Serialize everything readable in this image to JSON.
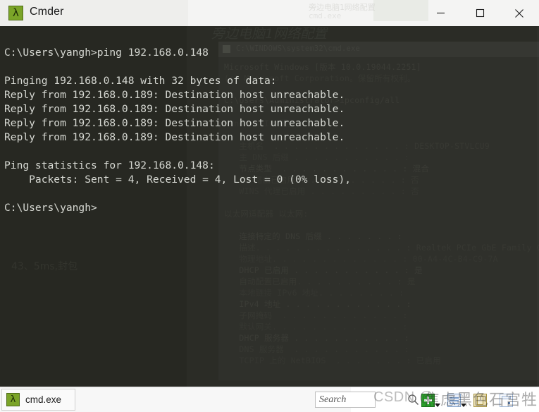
{
  "window": {
    "title": "Cmder",
    "app_icon": "lambda-icon",
    "controls": {
      "minimize": "minimize-icon",
      "maximize": "maximize-icon",
      "close": "close-icon"
    }
  },
  "terminal": {
    "lines": [
      "C:\\Users\\yangh>ping 192.168.0.148",
      "",
      "Pinging 192.168.0.148 with 32 bytes of data:",
      "Reply from 192.168.0.189: Destination host unreachable.",
      "Reply from 192.168.0.189: Destination host unreachable.",
      "Reply from 192.168.0.189: Destination host unreachable.",
      "Reply from 192.168.0.189: Destination host unreachable.",
      "",
      "Ping statistics for 192.168.0.148:",
      "    Packets: Sent = 4, Received = 4, Lost = 0 (0% loss),",
      "",
      "C:\\Users\\yangh>"
    ],
    "background_color": "#272822",
    "text_color": "#d6d8d2"
  },
  "background_window": {
    "header": "旁边电脑1网络配置",
    "cmd_title": "C:\\WINDOWS\\system32\\cmd.exe",
    "left_note": "43、5ms,封包",
    "lines": [
      "Microsoft Windows [版本 10.0.19044.2251]",
      "(c) Microsoft Corporation。保留所有权利。",
      "",
      "C:\\Users\\Administrator>ipconfig/all",
      "",
      "Windows IP 配置",
      "",
      "   主机名  . . . . . . . . . . . . . : DESKTOP-STVLCU9",
      "   主 DNS 后缀 . . . . . . . . . . . :",
      "   节点类型  . . . . . . . . . . . . : 混合",
      "   IP 路由已启用 . . . . . . . . . . : 否",
      "   WINS 代理已启用 . . . . . . . . . : 否",
      "",
      "以太网适配器 以太网:",
      "",
      "   连接特定的 DNS 后缀 . . . . . . . :",
      "   描述. . . . . . . . . . . . . . . : Realtek PCIe GbE Family Controller",
      "   物理地址. . . . . . . . . . . . . : 00-A4-4C-B4-C9-7A",
      "   DHCP 已启用 . . . . . . . . . . . : 是",
      "   自动配置已启用. . . . . . . . . . : 是",
      "   本地链接 IPv6 地址. . . . . . . . :",
      "   IPv4 地址 . . . . . . . . . . . . :",
      "   子网掩码  . . . . . . . . . . . . :",
      "   默认网关. . . . . . . . . . . . . :",
      "   DHCP 服务器 . . . . . . . . . . . :",
      "   DNS 服务器  . . . . . . . . . . . :",
      "   TCPIP 上的 NetBIOS  . . . . . . . : 已启用"
    ]
  },
  "statusbar": {
    "tab": {
      "label": "cmd.exe",
      "icon": "lambda-icon"
    },
    "search": {
      "placeholder": "Search",
      "value": "",
      "icon": "search-icon"
    },
    "toolbar": [
      {
        "name": "new-console-button",
        "icon": "green-plus-icon",
        "has_caret": true
      },
      {
        "name": "open-tabs-button",
        "icon": "blue-list-icon",
        "has_caret": true
      },
      {
        "name": "settings-button",
        "icon": "gold-book-icon",
        "has_caret": false
      },
      {
        "name": "layout-button",
        "icon": "white-panel-icon",
        "has_caret": false
      }
    ]
  },
  "watermark": {
    "text": "CSDN @",
    "chinese": "焦虑黑色石宫牲"
  },
  "colors": {
    "terminal_bg": "#272822",
    "terminal_fg": "#d6d8d2",
    "accent_green": "#7ba428",
    "titlebar_bg": "#f1f1f0",
    "statusbar_bg": "#f7f7f7"
  }
}
